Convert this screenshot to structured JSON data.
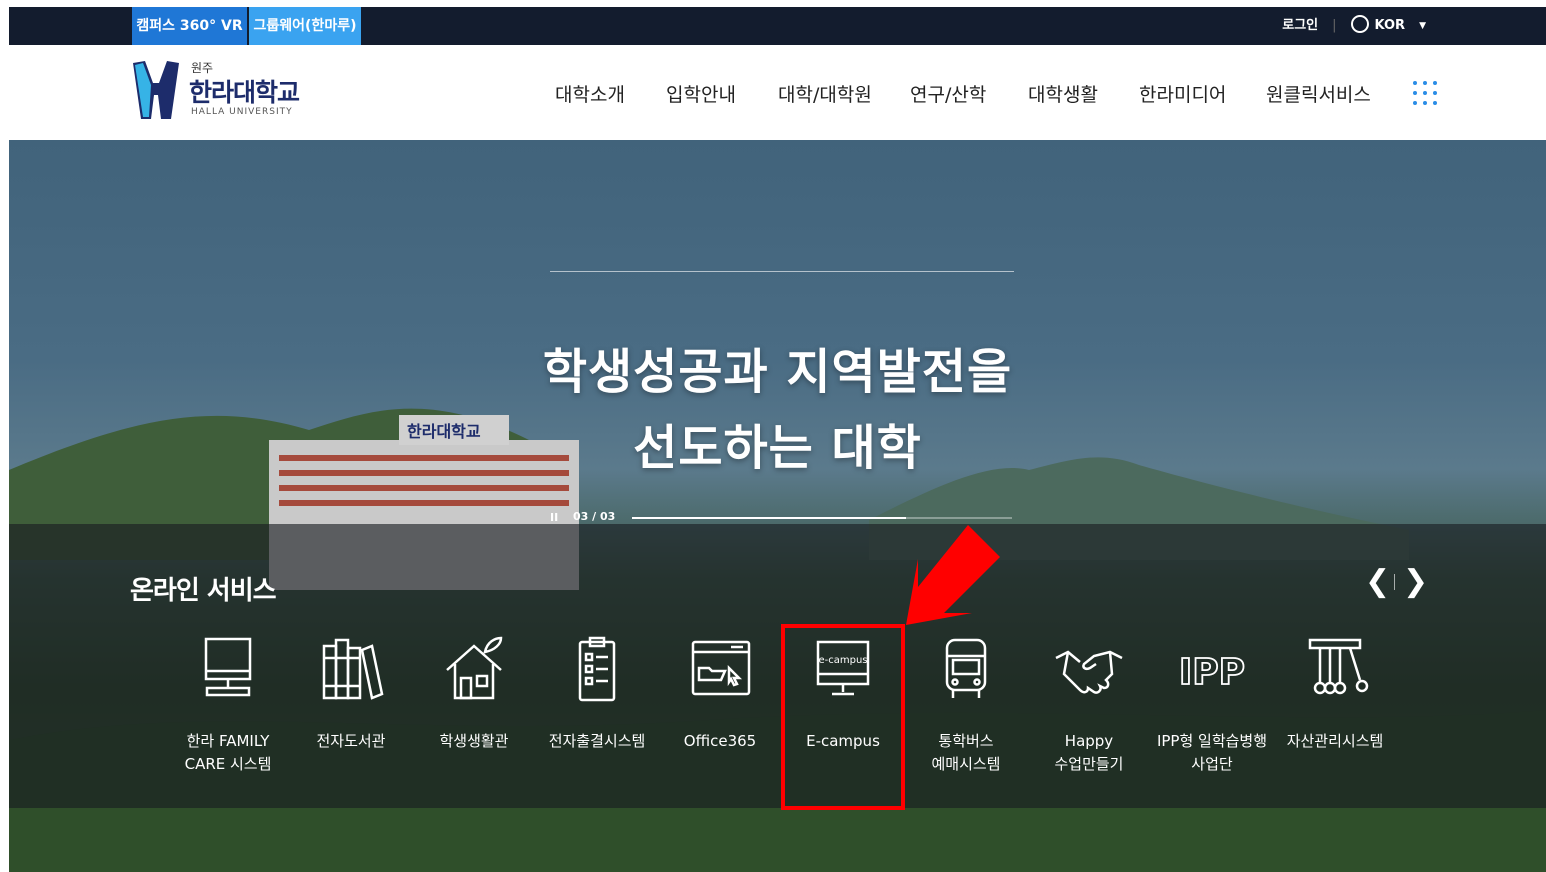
{
  "topbar": {
    "vr_label": "캠퍼스 360° VR",
    "groupware_label": "그룹웨어(한마루)",
    "login_label": "로그인",
    "language": "KOR"
  },
  "header": {
    "logo": {
      "small": "원주",
      "main": "한라대학교",
      "sub": "HALLA UNIVERSITY"
    },
    "nav": [
      "대학소개",
      "입학안내",
      "대학/대학원",
      "연구/산학",
      "대학생활",
      "한라미디어",
      "원클릭서비스"
    ]
  },
  "hero": {
    "title_line1": "학생성공과 지역발전을",
    "title_line2": "선도하는 대학",
    "slide_counter": "03 / 03",
    "slide_progress": 0.72
  },
  "services": {
    "title": "온라인 서비스",
    "items": [
      {
        "line1": "한라 FAMILY",
        "line2": "CARE 시스템",
        "icon": "monitor-icon"
      },
      {
        "line1": "전자도서관",
        "line2": "",
        "icon": "books-icon"
      },
      {
        "line1": "학생생활관",
        "line2": "",
        "icon": "house-icon"
      },
      {
        "line1": "전자출결시스템",
        "line2": "",
        "icon": "checklist-icon"
      },
      {
        "line1": "Office365",
        "line2": "",
        "icon": "browser-folder-icon"
      },
      {
        "line1": "E-campus",
        "line2": "",
        "icon": "ecampus-monitor-icon",
        "icon_text": "e-campus"
      },
      {
        "line1": "통학버스",
        "line2": "예매시스템",
        "icon": "bus-icon"
      },
      {
        "line1": "Happy",
        "line2": "수업만들기",
        "icon": "handshake-icon"
      },
      {
        "line1": "IPP형 일학습병행",
        "line2": "사업단",
        "icon": "ipp-icon",
        "icon_text": "IPP"
      },
      {
        "line1": "자산관리시스템",
        "line2": "",
        "icon": "cradle-icon"
      }
    ]
  },
  "colors": {
    "topbar_bg": "#131c2e",
    "vr_bg": "#1f77d6",
    "groupware_bg": "#3aa3f0",
    "logo_navy": "#1d2c6b",
    "highlight": "#ff0000"
  }
}
